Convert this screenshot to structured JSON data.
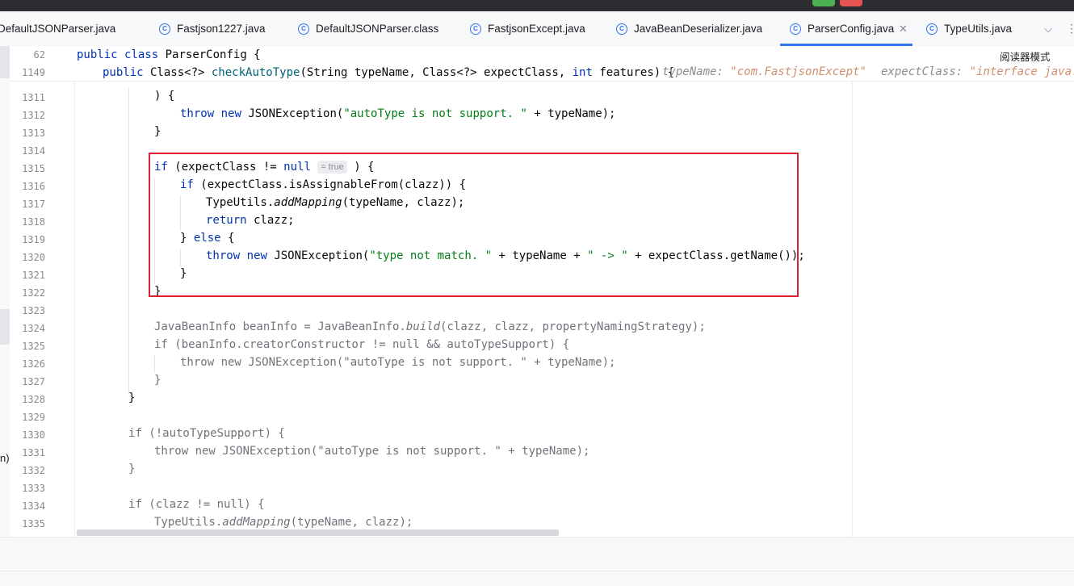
{
  "tabs": [
    {
      "label": "DefaultJSONParser.java"
    },
    {
      "label": "Fastjson1227.java"
    },
    {
      "label": "DefaultJSONParser.class"
    },
    {
      "label": "FastjsonExcept.java"
    },
    {
      "label": "JavaBeanDeserializer.java"
    },
    {
      "label": "ParserConfig.java",
      "active": true
    },
    {
      "label": "TypeUtils.java"
    }
  ],
  "reader_mode_label": "阅读器模式",
  "left_fragment": "n)",
  "sticky": {
    "line1": {
      "num": "62",
      "text": "public class ParserConfig {"
    },
    "line2": {
      "num": "1149",
      "text": "public Class<?> checkAutoType(String typeName, Class<?> expectClass, int features) {"
    },
    "inline_hint_1_label": "typeName: ",
    "inline_hint_1_value": "\"com.FastjsonExcept\"",
    "inline_hint_2_label": "expectClass: ",
    "inline_hint_2_value": "\"interface java.l"
  },
  "inlay_hint_true": "= true",
  "line_numbers": [
    "1311",
    "1312",
    "1313",
    "1314",
    "1315",
    "1316",
    "1317",
    "1318",
    "1319",
    "1320",
    "1321",
    "1322",
    "1323",
    "1324",
    "1325",
    "1326",
    "1327",
    "1328",
    "1329",
    "1330",
    "1331",
    "1332",
    "1333",
    "1334",
    "1335"
  ],
  "code": {
    "l1311": ") {",
    "l1312_kw1": "throw",
    "l1312_kw2": "new",
    "l1312_a": " JSONException(",
    "l1312_str": "\"autoType is not support. \"",
    "l1312_b": " + typeName);",
    "l1313": "}",
    "l1315_kw": "if",
    "l1315_a": " (expectClass != ",
    "l1315_null": "null",
    "l1315_b": ") {",
    "l1316_kw": "if",
    "l1316_a": " (expectClass.isAssignableFrom(clazz)) {",
    "l1317_a": "TypeUtils.",
    "l1317_fn": "addMapping",
    "l1317_b": "(typeName, clazz);",
    "l1318_kw": "return",
    "l1318_a": " clazz;",
    "l1319_a": "} ",
    "l1319_kw": "else",
    "l1319_b": " {",
    "l1320_kw1": "throw",
    "l1320_kw2": "new",
    "l1320_a": " JSONException(",
    "l1320_str1": "\"type not match. \"",
    "l1320_b": " + typeName + ",
    "l1320_str2": "\" -> \"",
    "l1320_c": " + expectClass.getName());",
    "l1321": "}",
    "l1322": "}",
    "l1324_a": "JavaBeanInfo beanInfo = JavaBeanInfo.",
    "l1324_fn": "build",
    "l1324_b": "(clazz, clazz, propertyNamingStrategy);",
    "l1325": "if (beanInfo.creatorConstructor != null && autoTypeSupport) {",
    "l1326": "throw new JSONException(\"autoType is not support. \" + typeName);",
    "l1327": "}",
    "l1328": "}",
    "l1330": "if (!autoTypeSupport) {",
    "l1331": "throw new JSONException(\"autoType is not support. \" + typeName);",
    "l1332": "}",
    "l1334": "if (clazz != null) {",
    "l1335_a": "TypeUtils.",
    "l1335_fn": "addMapping",
    "l1335_b": "(typeName, clazz);"
  },
  "colors": {
    "keyword": "#0033b3",
    "string": "#067d17",
    "highlight_box": "#e0202e",
    "active_tab_underline": "#3574f0"
  },
  "icons": [
    "class-file-icon",
    "close-icon",
    "chevron-down-icon",
    "more-icon"
  ]
}
